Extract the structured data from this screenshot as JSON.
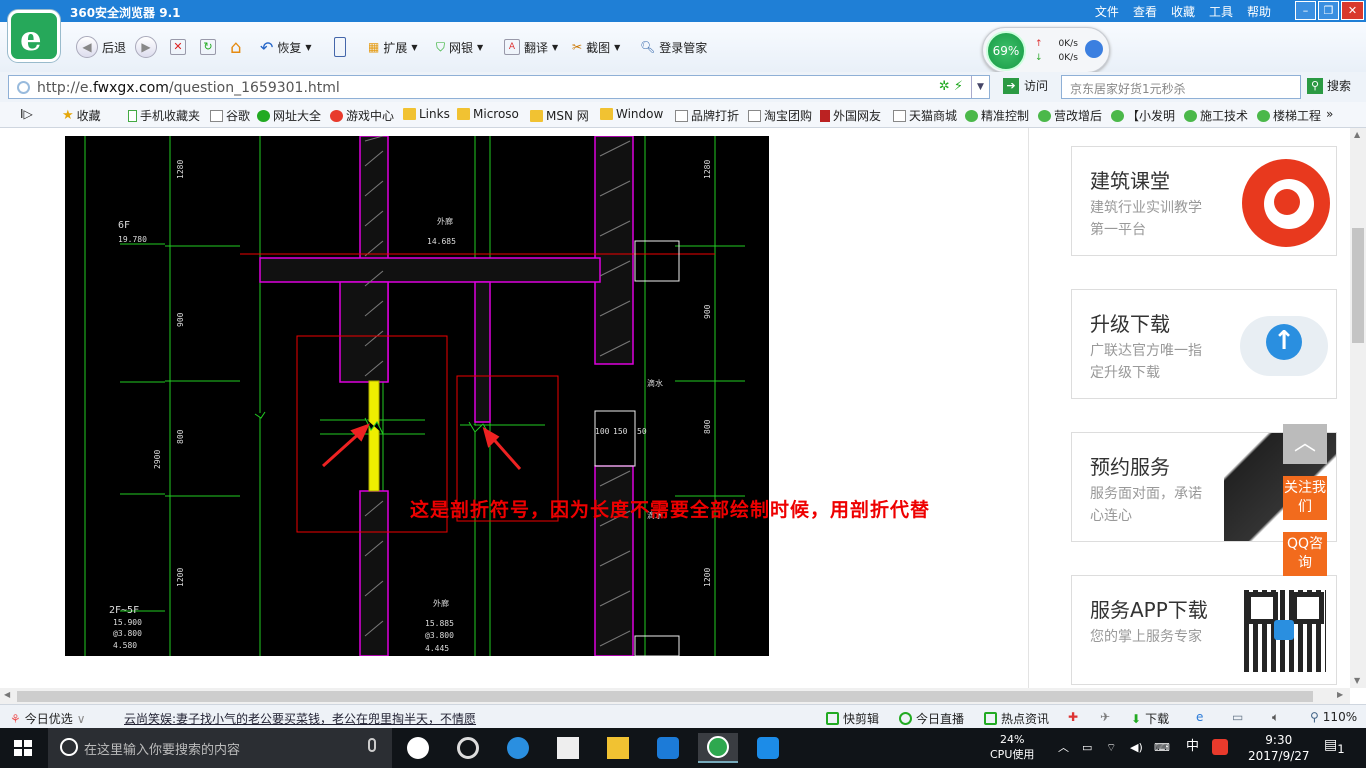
{
  "browser": {
    "title": "360安全浏览器 9.1",
    "menus": [
      "文件",
      "查看",
      "收藏",
      "工具",
      "帮助"
    ],
    "toolbar": {
      "back": "后退",
      "restore": "恢复",
      "extend": "扩展",
      "netbank": "网银",
      "translate": "翻译",
      "screenshot": "截图",
      "login": "登录管家"
    },
    "speed": {
      "percent": "69%",
      "up": "0K/s",
      "down": "0K/s"
    },
    "url_prefix": "http://e.",
    "url_host": "fwxgx.com",
    "url_path": "/question_1659301.html",
    "visit": "访问",
    "search_placeholder": "京东居家好货1元秒杀",
    "search_button": "搜索"
  },
  "favorites": [
    "收藏",
    "手机收藏夹",
    "谷歌",
    "网址大全",
    "游戏中心",
    "Links",
    "Microso",
    "MSN 网",
    "Window",
    "品牌打折",
    "淘宝团购",
    "外国网友",
    "天猫商城",
    "精准控制",
    "营改增后",
    "【小发明",
    "施工技术",
    "楼梯工程"
  ],
  "cad": {
    "labels": [
      "6F",
      "19.780",
      "外廊",
      "14.685",
      "2F~5F",
      "15.900",
      "@3.800",
      "4.580",
      "15.885",
      "@3.800",
      "4.445",
      "外廊",
      "滴水",
      "滴水",
      "100",
      "150",
      "50",
      "1280",
      "900",
      "800",
      "2900",
      "1200",
      "1280",
      "900",
      "800",
      "1200"
    ],
    "annotation": "这是剖折符号，因为长度不需要全部绘制时候，用剖折代替"
  },
  "sidebar": {
    "cards": [
      {
        "title": "建筑课堂",
        "desc": "建筑行业实训教学第一平台"
      },
      {
        "title": "升级下载",
        "desc": "广联达官方唯一指定升级下载"
      },
      {
        "title": "预约服务",
        "desc": "服务面对面，承诺心连心"
      },
      {
        "title": "服务APP下载",
        "desc": "您的掌上服务专家"
      }
    ],
    "follow": "关注我们",
    "qq": "QQ咨询",
    "to_top": "︿"
  },
  "statusbar": {
    "today": "今日优选",
    "news": "云尚笑娱:妻子找小气的老公要买菜钱，老公在兜里掏半天，不情愿",
    "items": [
      "快剪辑",
      "今日直播",
      "热点资讯",
      "下载"
    ],
    "zoom": "110%"
  },
  "taskbar": {
    "search_placeholder": "在这里输入你要搜索的内容",
    "cpu_percent": "24%",
    "cpu_label": "CPU使用",
    "ime": "中",
    "time": "9:30",
    "date": "2017/9/27",
    "notifications": "1"
  },
  "colors": {
    "accent": "#1f7fd6",
    "cad_bg": "#000000",
    "annotation": "#ee0000",
    "orange": "#f26b1d"
  }
}
